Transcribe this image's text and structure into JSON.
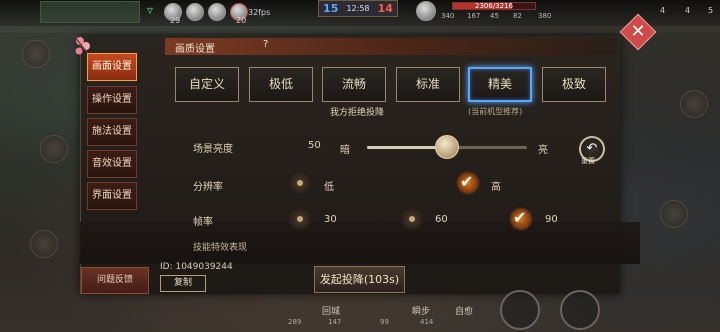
{
  "hud": {
    "fps": "32fps",
    "level_left_1": "29",
    "level_left_2": "20",
    "score_blue": "15",
    "match_time": "12:58",
    "score_red": "14",
    "hp_text": "2306/3216",
    "hp_fraction": 0.717,
    "stats": [
      "340",
      "167",
      "45",
      "82",
      "380"
    ],
    "right_stats": [
      "4",
      "4",
      "5"
    ]
  },
  "nav": {
    "tabs": [
      {
        "label": "画面设置",
        "active": true
      },
      {
        "label": "操作设置",
        "active": false
      },
      {
        "label": "施法设置",
        "active": false
      },
      {
        "label": "音效设置",
        "active": false
      },
      {
        "label": "界面设置",
        "active": false
      }
    ]
  },
  "quality_section": {
    "title": "画质设置",
    "help_icon": "?",
    "options": [
      "自定义",
      "极低",
      "流畅",
      "标准",
      "精美",
      "极致"
    ],
    "selected": "精美",
    "warning": "我方拒绝投降",
    "recommend_note": "(当前机型推荐)"
  },
  "brightness": {
    "label": "场景亮度",
    "value": 50,
    "min_label": "暗",
    "max_label": "亮",
    "reset_label": "重置",
    "reset_icon": "undo-arrow-icon"
  },
  "resolution": {
    "label": "分辨率",
    "options": [
      {
        "label": "低",
        "checked": false
      },
      {
        "label": "高",
        "checked": true
      }
    ]
  },
  "framerate": {
    "label": "帧率",
    "options": [
      {
        "label": "30",
        "checked": false
      },
      {
        "label": "60",
        "checked": false
      },
      {
        "label": "90",
        "checked": true
      }
    ]
  },
  "next_section": "技能特效表现",
  "footer": {
    "feedback": "问题反馈",
    "game_id": "ID: 1049039244",
    "copy": "复制",
    "surrender": "发起投降(103s)",
    "close_icon": "close-icon"
  },
  "bottom_hud": {
    "skills": [
      "回城",
      "瞬步",
      "自愈"
    ],
    "stats": [
      "289",
      "147",
      "99",
      "414"
    ]
  }
}
